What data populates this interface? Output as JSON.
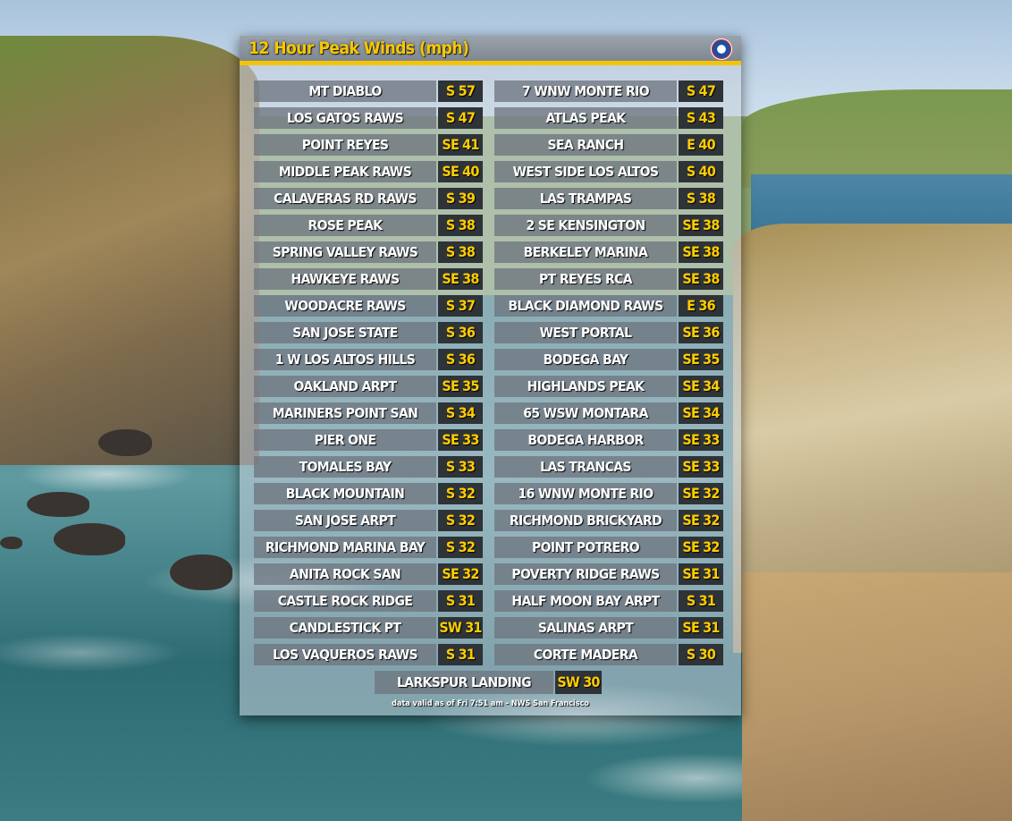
{
  "panel": {
    "title": "12 Hour Peak Winds (mph)",
    "footer": "data valid as of Fri 7:51 am - NWS San Francisco",
    "accent_color": "#f5c400"
  },
  "left_column": [
    {
      "station": "MT DIABLO",
      "wind": "S 57"
    },
    {
      "station": "LOS GATOS RAWS",
      "wind": "S 47"
    },
    {
      "station": "POINT REYES",
      "wind": "SE 41"
    },
    {
      "station": "MIDDLE PEAK RAWS",
      "wind": "SE 40"
    },
    {
      "station": "CALAVERAS RD RAWS",
      "wind": "S 39"
    },
    {
      "station": "ROSE PEAK",
      "wind": "S 38"
    },
    {
      "station": "SPRING VALLEY RAWS",
      "wind": "S 38"
    },
    {
      "station": "HAWKEYE RAWS",
      "wind": "SE 38"
    },
    {
      "station": "WOODACRE RAWS",
      "wind": "S 37"
    },
    {
      "station": "SAN JOSE STATE",
      "wind": "S 36"
    },
    {
      "station": "1 W LOS ALTOS HILLS",
      "wind": "S 36"
    },
    {
      "station": "OAKLAND ARPT",
      "wind": "SE 35"
    },
    {
      "station": "MARINERS POINT SAN",
      "wind": "S 34"
    },
    {
      "station": "PIER ONE",
      "wind": "SE 33"
    },
    {
      "station": "TOMALES BAY",
      "wind": "S 33"
    },
    {
      "station": "BLACK MOUNTAIN",
      "wind": "S 32"
    },
    {
      "station": "SAN JOSE ARPT",
      "wind": "S 32"
    },
    {
      "station": "RICHMOND MARINA BAY",
      "wind": "S 32"
    },
    {
      "station": "ANITA ROCK SAN",
      "wind": "SE 32"
    },
    {
      "station": "CASTLE ROCK RIDGE",
      "wind": "S 31"
    },
    {
      "station": "CANDLESTICK PT",
      "wind": "SW 31"
    },
    {
      "station": "LOS VAQUEROS RAWS",
      "wind": "S 31"
    }
  ],
  "right_column": [
    {
      "station": "7 WNW MONTE RIO",
      "wind": "S 47"
    },
    {
      "station": "ATLAS PEAK",
      "wind": "S 43"
    },
    {
      "station": "SEA RANCH",
      "wind": "E 40"
    },
    {
      "station": "WEST SIDE LOS ALTOS",
      "wind": "S 40"
    },
    {
      "station": "LAS TRAMPAS",
      "wind": "S 38"
    },
    {
      "station": "2 SE KENSINGTON",
      "wind": "SE 38"
    },
    {
      "station": "BERKELEY MARINA",
      "wind": "SE 38"
    },
    {
      "station": "PT REYES RCA",
      "wind": "SE 38"
    },
    {
      "station": "BLACK DIAMOND RAWS",
      "wind": "E 36"
    },
    {
      "station": "WEST PORTAL",
      "wind": "SE 36"
    },
    {
      "station": "BODEGA BAY",
      "wind": "SE 35"
    },
    {
      "station": "HIGHLANDS PEAK",
      "wind": "SE 34"
    },
    {
      "station": "65 WSW MONTARA",
      "wind": "SE 34"
    },
    {
      "station": "BODEGA HARBOR",
      "wind": "SE 33"
    },
    {
      "station": "LAS TRANCAS",
      "wind": "SE 33"
    },
    {
      "station": "16 WNW MONTE RIO",
      "wind": "SE 32"
    },
    {
      "station": "RICHMOND BRICKYARD",
      "wind": "SE 32"
    },
    {
      "station": "POINT POTRERO",
      "wind": "SE 32"
    },
    {
      "station": "POVERTY RIDGE RAWS",
      "wind": "SE 31"
    },
    {
      "station": "HALF MOON BAY ARPT",
      "wind": "S 31"
    },
    {
      "station": "SALINAS ARPT",
      "wind": "SE 31"
    },
    {
      "station": "CORTE MADERA",
      "wind": "S 30"
    }
  ],
  "last_row": {
    "station": "LARKSPUR LANDING",
    "wind": "SW 30"
  }
}
